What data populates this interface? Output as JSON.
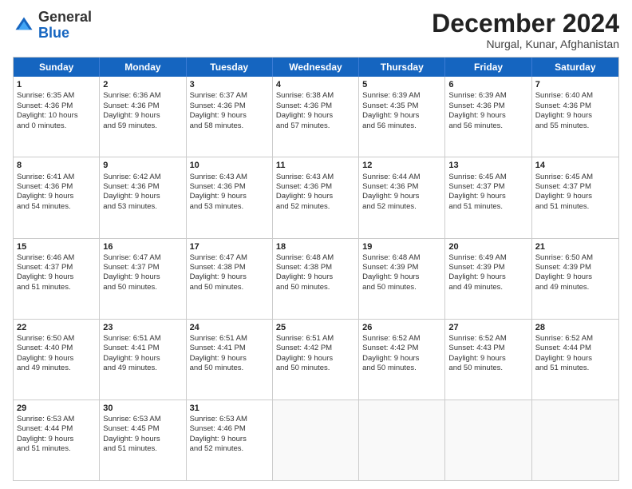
{
  "logo": {
    "general": "General",
    "blue": "Blue"
  },
  "title": "December 2024",
  "subtitle": "Nurgal, Kunar, Afghanistan",
  "header_days": [
    "Sunday",
    "Monday",
    "Tuesday",
    "Wednesday",
    "Thursday",
    "Friday",
    "Saturday"
  ],
  "weeks": [
    [
      {
        "day": "1",
        "lines": [
          "Sunrise: 6:35 AM",
          "Sunset: 4:36 PM",
          "Daylight: 10 hours",
          "and 0 minutes."
        ]
      },
      {
        "day": "2",
        "lines": [
          "Sunrise: 6:36 AM",
          "Sunset: 4:36 PM",
          "Daylight: 9 hours",
          "and 59 minutes."
        ]
      },
      {
        "day": "3",
        "lines": [
          "Sunrise: 6:37 AM",
          "Sunset: 4:36 PM",
          "Daylight: 9 hours",
          "and 58 minutes."
        ]
      },
      {
        "day": "4",
        "lines": [
          "Sunrise: 6:38 AM",
          "Sunset: 4:36 PM",
          "Daylight: 9 hours",
          "and 57 minutes."
        ]
      },
      {
        "day": "5",
        "lines": [
          "Sunrise: 6:39 AM",
          "Sunset: 4:35 PM",
          "Daylight: 9 hours",
          "and 56 minutes."
        ]
      },
      {
        "day": "6",
        "lines": [
          "Sunrise: 6:39 AM",
          "Sunset: 4:36 PM",
          "Daylight: 9 hours",
          "and 56 minutes."
        ]
      },
      {
        "day": "7",
        "lines": [
          "Sunrise: 6:40 AM",
          "Sunset: 4:36 PM",
          "Daylight: 9 hours",
          "and 55 minutes."
        ]
      }
    ],
    [
      {
        "day": "8",
        "lines": [
          "Sunrise: 6:41 AM",
          "Sunset: 4:36 PM",
          "Daylight: 9 hours",
          "and 54 minutes."
        ]
      },
      {
        "day": "9",
        "lines": [
          "Sunrise: 6:42 AM",
          "Sunset: 4:36 PM",
          "Daylight: 9 hours",
          "and 53 minutes."
        ]
      },
      {
        "day": "10",
        "lines": [
          "Sunrise: 6:43 AM",
          "Sunset: 4:36 PM",
          "Daylight: 9 hours",
          "and 53 minutes."
        ]
      },
      {
        "day": "11",
        "lines": [
          "Sunrise: 6:43 AM",
          "Sunset: 4:36 PM",
          "Daylight: 9 hours",
          "and 52 minutes."
        ]
      },
      {
        "day": "12",
        "lines": [
          "Sunrise: 6:44 AM",
          "Sunset: 4:36 PM",
          "Daylight: 9 hours",
          "and 52 minutes."
        ]
      },
      {
        "day": "13",
        "lines": [
          "Sunrise: 6:45 AM",
          "Sunset: 4:37 PM",
          "Daylight: 9 hours",
          "and 51 minutes."
        ]
      },
      {
        "day": "14",
        "lines": [
          "Sunrise: 6:45 AM",
          "Sunset: 4:37 PM",
          "Daylight: 9 hours",
          "and 51 minutes."
        ]
      }
    ],
    [
      {
        "day": "15",
        "lines": [
          "Sunrise: 6:46 AM",
          "Sunset: 4:37 PM",
          "Daylight: 9 hours",
          "and 51 minutes."
        ]
      },
      {
        "day": "16",
        "lines": [
          "Sunrise: 6:47 AM",
          "Sunset: 4:37 PM",
          "Daylight: 9 hours",
          "and 50 minutes."
        ]
      },
      {
        "day": "17",
        "lines": [
          "Sunrise: 6:47 AM",
          "Sunset: 4:38 PM",
          "Daylight: 9 hours",
          "and 50 minutes."
        ]
      },
      {
        "day": "18",
        "lines": [
          "Sunrise: 6:48 AM",
          "Sunset: 4:38 PM",
          "Daylight: 9 hours",
          "and 50 minutes."
        ]
      },
      {
        "day": "19",
        "lines": [
          "Sunrise: 6:48 AM",
          "Sunset: 4:39 PM",
          "Daylight: 9 hours",
          "and 50 minutes."
        ]
      },
      {
        "day": "20",
        "lines": [
          "Sunrise: 6:49 AM",
          "Sunset: 4:39 PM",
          "Daylight: 9 hours",
          "and 49 minutes."
        ]
      },
      {
        "day": "21",
        "lines": [
          "Sunrise: 6:50 AM",
          "Sunset: 4:39 PM",
          "Daylight: 9 hours",
          "and 49 minutes."
        ]
      }
    ],
    [
      {
        "day": "22",
        "lines": [
          "Sunrise: 6:50 AM",
          "Sunset: 4:40 PM",
          "Daylight: 9 hours",
          "and 49 minutes."
        ]
      },
      {
        "day": "23",
        "lines": [
          "Sunrise: 6:51 AM",
          "Sunset: 4:41 PM",
          "Daylight: 9 hours",
          "and 49 minutes."
        ]
      },
      {
        "day": "24",
        "lines": [
          "Sunrise: 6:51 AM",
          "Sunset: 4:41 PM",
          "Daylight: 9 hours",
          "and 50 minutes."
        ]
      },
      {
        "day": "25",
        "lines": [
          "Sunrise: 6:51 AM",
          "Sunset: 4:42 PM",
          "Daylight: 9 hours",
          "and 50 minutes."
        ]
      },
      {
        "day": "26",
        "lines": [
          "Sunrise: 6:52 AM",
          "Sunset: 4:42 PM",
          "Daylight: 9 hours",
          "and 50 minutes."
        ]
      },
      {
        "day": "27",
        "lines": [
          "Sunrise: 6:52 AM",
          "Sunset: 4:43 PM",
          "Daylight: 9 hours",
          "and 50 minutes."
        ]
      },
      {
        "day": "28",
        "lines": [
          "Sunrise: 6:52 AM",
          "Sunset: 4:44 PM",
          "Daylight: 9 hours",
          "and 51 minutes."
        ]
      }
    ],
    [
      {
        "day": "29",
        "lines": [
          "Sunrise: 6:53 AM",
          "Sunset: 4:44 PM",
          "Daylight: 9 hours",
          "and 51 minutes."
        ]
      },
      {
        "day": "30",
        "lines": [
          "Sunrise: 6:53 AM",
          "Sunset: 4:45 PM",
          "Daylight: 9 hours",
          "and 51 minutes."
        ]
      },
      {
        "day": "31",
        "lines": [
          "Sunrise: 6:53 AM",
          "Sunset: 4:46 PM",
          "Daylight: 9 hours",
          "and 52 minutes."
        ]
      },
      {
        "day": "",
        "lines": []
      },
      {
        "day": "",
        "lines": []
      },
      {
        "day": "",
        "lines": []
      },
      {
        "day": "",
        "lines": []
      }
    ]
  ]
}
